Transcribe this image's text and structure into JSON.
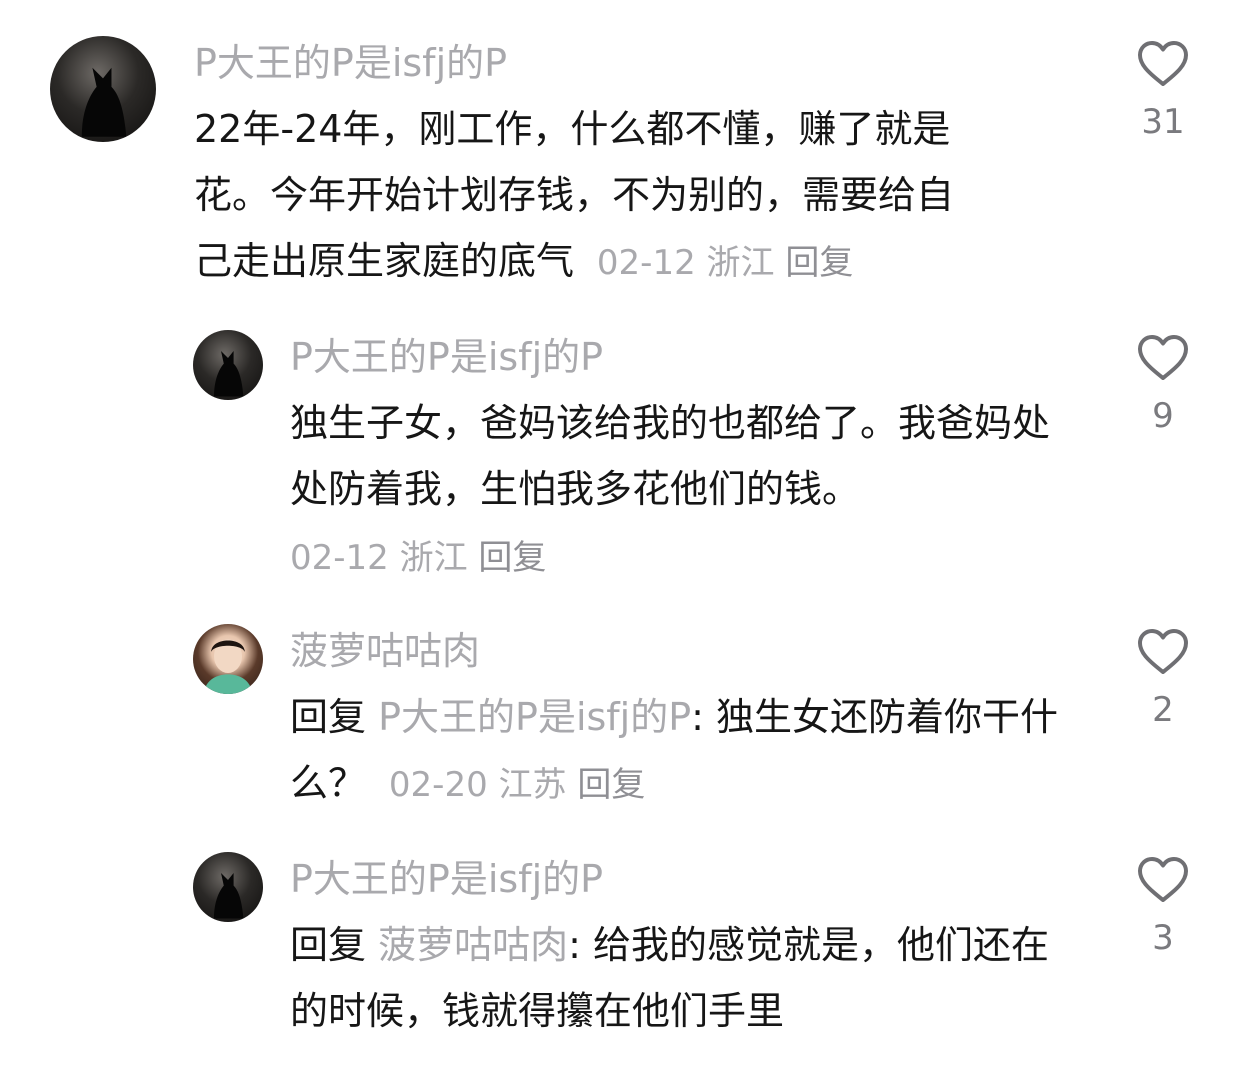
{
  "comments": [
    {
      "user": "P大王的P是isfj的P",
      "text": "22年-24年，刚工作，什么都不懂，赚了就是花。今年开始计划存钱，不为别的，需要给自己走出原生家庭的底气",
      "date": "02-12",
      "location": "浙江",
      "reply_label": "回复",
      "likes": "31",
      "avatar": "black-cat-avatar"
    },
    {
      "user": "P大王的P是isfj的P",
      "text": "独生子女，爸妈该给我的也都给了。我爸妈处处防着我，生怕我多花他们的钱。",
      "date": "02-12",
      "location": "浙江",
      "reply_label": "回复",
      "likes": "9",
      "avatar": "black-cat-avatar"
    },
    {
      "user": "菠萝咕咕肉",
      "reply_prefix": "回复",
      "mention": "P大王的P是isfj的P",
      "text": ": 独生女还防着你干什么？",
      "date": "02-20",
      "location": "江苏",
      "reply_label": "回复",
      "likes": "2",
      "avatar": "girl-avatar"
    },
    {
      "user": "P大王的P是isfj的P",
      "reply_prefix": "回复",
      "mention": "菠萝咕咕肉",
      "text": ": 给我的感觉就是，他们还在的时候，钱就得攥在他们手里",
      "likes": "3",
      "avatar": "black-cat-avatar"
    }
  ],
  "colors": {
    "text": "#161616",
    "meta": "#a9a9ad",
    "like_icon": "#6f6f73",
    "background": "#ffffff"
  }
}
